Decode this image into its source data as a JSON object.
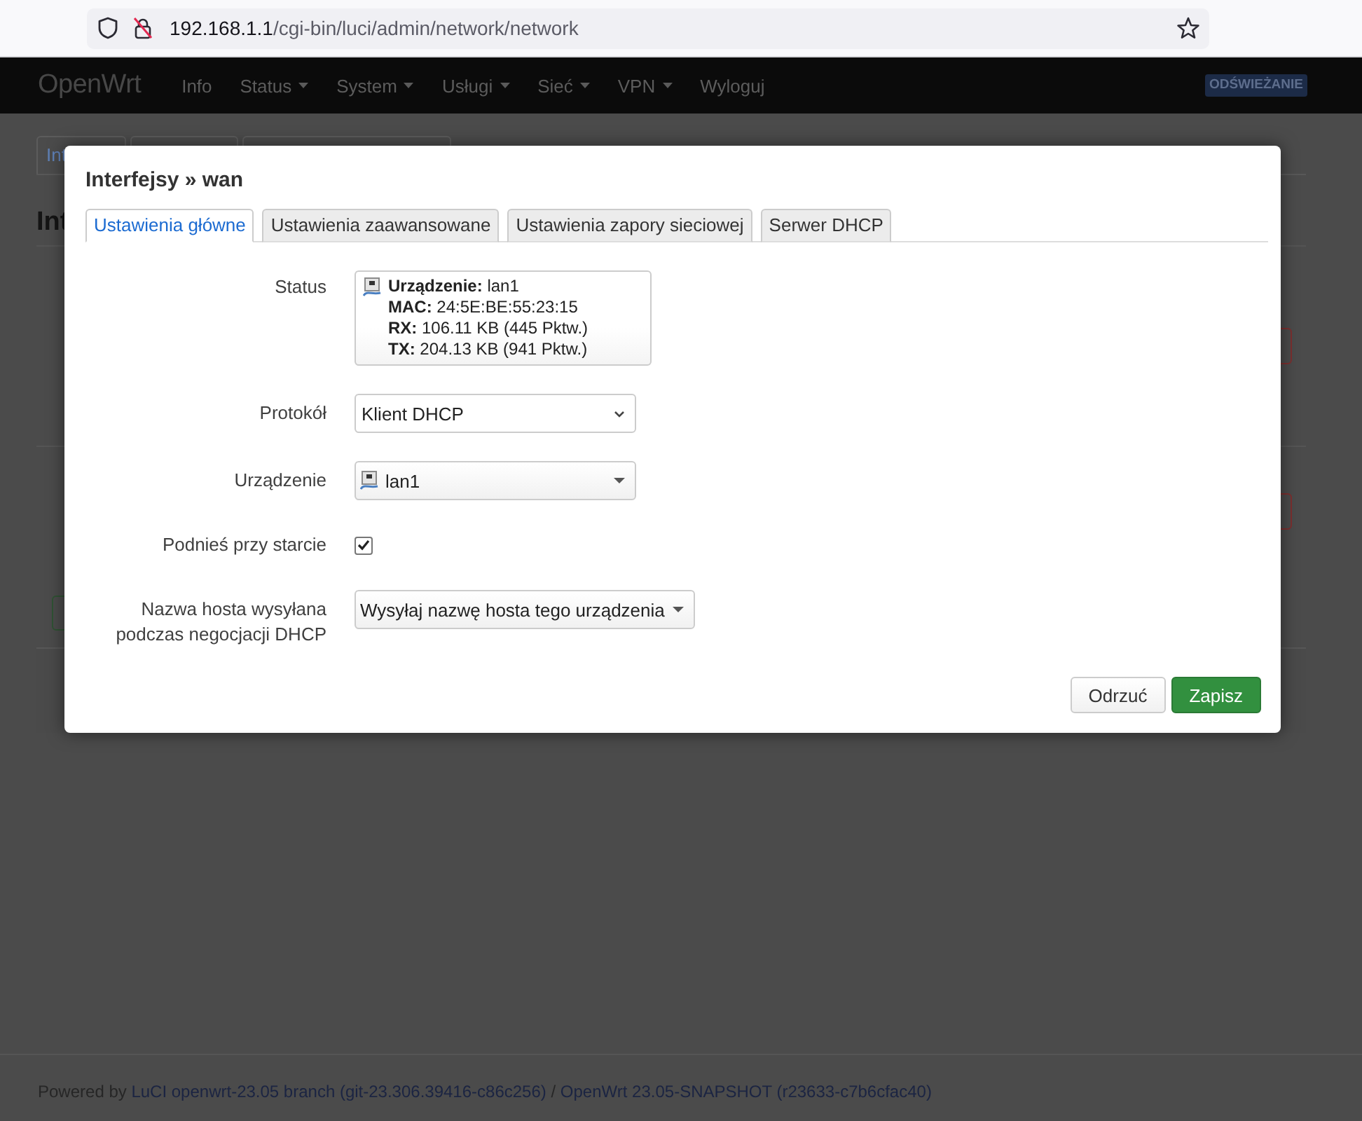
{
  "browser": {
    "url": {
      "host": "192.168.1.1",
      "path": "/cgi-bin/luci/admin/network/network"
    }
  },
  "navbar": {
    "brand": "OpenWrt",
    "menu": [
      {
        "label": "Info",
        "has_menu": false
      },
      {
        "label": "Status",
        "has_menu": true
      },
      {
        "label": "System",
        "has_menu": true
      },
      {
        "label": "Usługi",
        "has_menu": true
      },
      {
        "label": "Sieć",
        "has_menu": true
      },
      {
        "label": "VPN",
        "has_menu": true
      },
      {
        "label": "Wyloguj",
        "has_menu": false
      }
    ],
    "indicator": "ODŚWIEŻANIE"
  },
  "page": {
    "tabs": [
      {
        "label": "Int"
      }
    ],
    "heading": "Int"
  },
  "modal": {
    "title": "Interfejsy » wan",
    "tabs": [
      {
        "label": "Ustawienia główne",
        "selected": true
      },
      {
        "label": "Ustawienia zaawansowane",
        "selected": false
      },
      {
        "label": "Ustawienia zapory sieciowej",
        "selected": false
      },
      {
        "label": "Serwer DHCP",
        "selected": false
      }
    ],
    "fields": [
      {
        "kind": "status",
        "label": "Status",
        "lines": [
          "**Urządzenie:** lan1",
          "**MAC:** 24:5E:BE:55:23:15",
          "**RX:** 106.11 KB (445 Pktw.)",
          "**TX:** 204.13 KB (941 Pktw.)"
        ]
      },
      {
        "kind": "select",
        "label": "Protokół",
        "value": "Klient DHCP"
      },
      {
        "kind": "device-dropdown",
        "label": "Urządzenie",
        "value": "lan1"
      },
      {
        "kind": "checkbox",
        "label": "Podnieś przy starcie",
        "checked": true
      },
      {
        "kind": "dropdown",
        "label": "Nazwa hosta wysyłana podczas negocjacji DHCP",
        "value": "Wysyłaj nazwę hosta tego urządzenia"
      }
    ],
    "buttons": [
      {
        "label": "Odrzuć",
        "kind": "reset"
      },
      {
        "label": "Zapisz",
        "kind": "save"
      }
    ]
  },
  "footer": {
    "prefix": "Powered by",
    "links": [
      "LuCI openwrt-23.05 branch (git-23.306.39416-c86c256)",
      "OpenWrt 23.05-SNAPSHOT (r23633-c7b6cfac40)"
    ],
    "separator": "/"
  }
}
